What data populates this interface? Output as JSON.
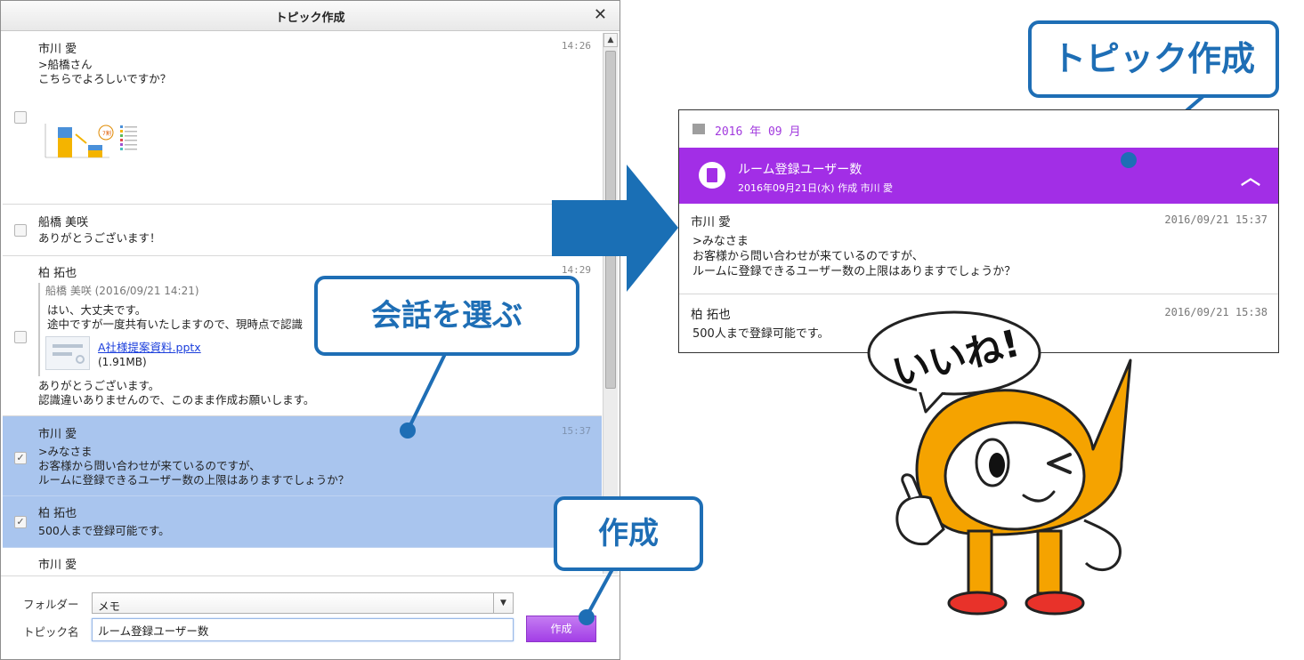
{
  "dialog": {
    "title": "トピック作成",
    "close_icon": "close-icon",
    "messages": [
      {
        "sender": "市川 愛",
        "time": "14:26",
        "text": ">船橋さん\nこちらでよろしいですか？",
        "checked": false,
        "attachment": "chart-thumbnail"
      },
      {
        "sender": "船橋 美咲",
        "time": "",
        "text": "ありがとうございます！",
        "checked": false
      },
      {
        "sender": "柏 拓也",
        "time": "14:29",
        "quote_header": "船橋 美咲 (2016/09/21 14:21)",
        "quote_text": "はい、大丈夫です。\n途中ですが一度共有いたしますので、現時点で認識",
        "file_name": "A社様提案資料.pptx",
        "file_size": "(1.91MB)",
        "text": "ありがとうございます。\n認識違いありませんので、このまま作成お願いします。",
        "checked": false
      },
      {
        "sender": "市川 愛",
        "time": "15:37",
        "text": ">みなさま\nお客様から問い合わせが来ているのですが、\nルームに登録できるユーザー数の上限はありますでしょうか？",
        "checked": true
      },
      {
        "sender": "柏 拓也",
        "time": "",
        "text": "500人まで登録可能です。",
        "checked": true
      },
      {
        "sender": "市川 愛",
        "time": "",
        "text": "",
        "checked": false
      }
    ],
    "form": {
      "folder_label": "フォルダー",
      "folder_value": "メモ",
      "topic_label": "トピック名",
      "topic_value": "ルーム登録ユーザー数",
      "create_label": "作成"
    }
  },
  "callouts": {
    "select_conversation": "会話を選ぶ",
    "create": "作成",
    "topic_create": "トピック作成"
  },
  "result": {
    "month": "2016 年 09 月",
    "topic_title": "ルーム登録ユーザー数",
    "topic_meta": "2016年09月21日(水) 作成 市川 愛",
    "messages": [
      {
        "sender": "市川 愛",
        "time": "2016/09/21 15:37",
        "text": ">みなさま\nお客様から問い合わせが来ているのですが、\nルームに登録できるユーザー数の上限はありますでしょうか？"
      },
      {
        "sender": "柏 拓也",
        "time": "2016/09/21 15:38",
        "text": "500人まで登録可能です。"
      }
    ]
  },
  "mascot": {
    "speech": "いいね!"
  },
  "colors": {
    "accent_purple": "#a22ee6",
    "selection_blue": "#a9c5ee",
    "callout_blue": "#1e6eb5",
    "arrow_blue": "#1a6fb5",
    "mascot_orange": "#f5a300"
  }
}
